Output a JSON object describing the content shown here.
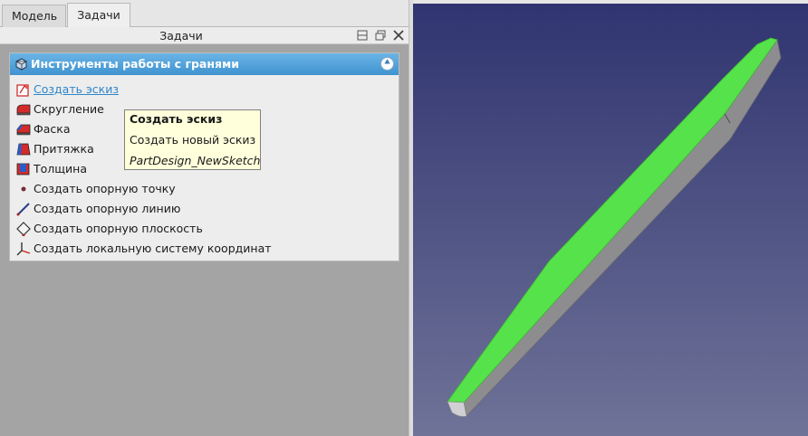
{
  "tabs": {
    "model_label": "Модель",
    "tasks_label": "Задачи"
  },
  "panel": {
    "title": "Задачи"
  },
  "task_box": {
    "title": "Инструменты работы с гранями",
    "items": [
      {
        "label": "Создать эскиз",
        "icon": "sketch-icon"
      },
      {
        "label": "Скругление",
        "icon": "fillet-icon"
      },
      {
        "label": "Фаска",
        "icon": "chamfer-icon"
      },
      {
        "label": "Притяжка",
        "icon": "draft-icon"
      },
      {
        "label": "Толщина",
        "icon": "thickness-icon"
      },
      {
        "label": "Создать опорную точку",
        "icon": "datum-point-icon"
      },
      {
        "label": "Создать опорную линию",
        "icon": "datum-line-icon"
      },
      {
        "label": "Создать опорную плоскость",
        "icon": "datum-plane-icon"
      },
      {
        "label": "Создать локальную систему координат",
        "icon": "local-cs-icon"
      }
    ]
  },
  "tooltip": {
    "title": "Создать эскиз",
    "description": "Создать новый эскиз",
    "command": "PartDesign_NewSketch"
  },
  "colors": {
    "face_selected": "#55e24a",
    "body_gray": "#8d8d90",
    "box_header": "#4a9fd8",
    "view_top": "#303470",
    "view_bottom": "#6f7398"
  }
}
